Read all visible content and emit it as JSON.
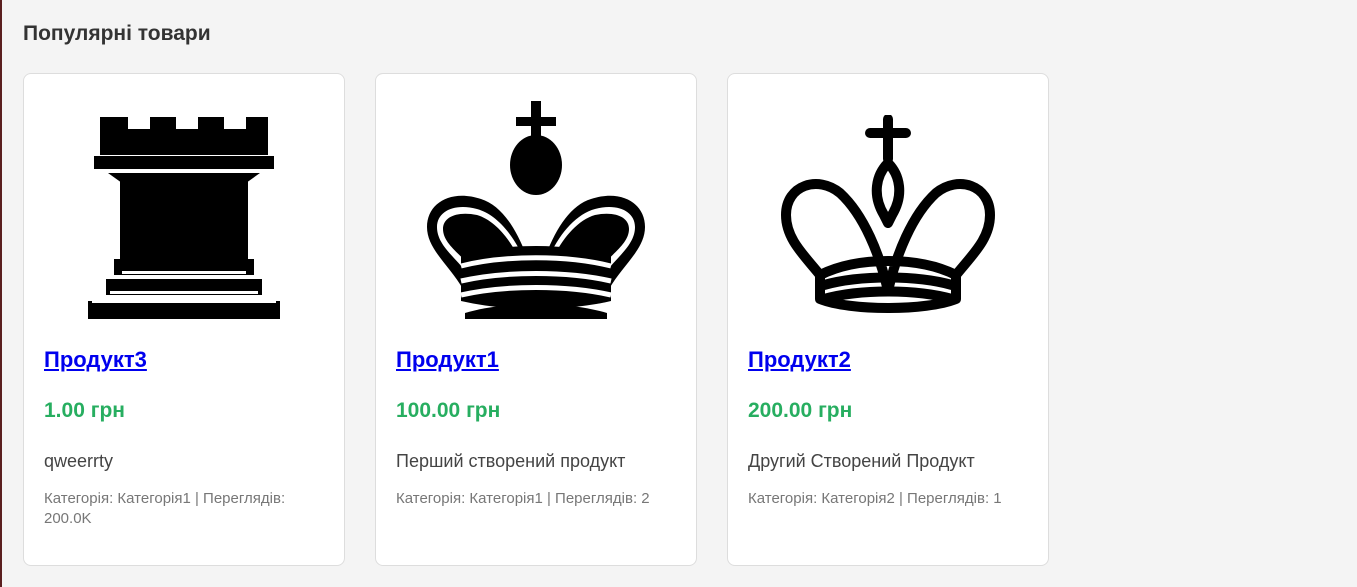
{
  "section": {
    "title": "Популярні товари"
  },
  "products": [
    {
      "icon": "chess-rook-black-icon",
      "name": "Продукт3",
      "price": "1.00 грн",
      "description": "qweerrty",
      "meta": "Категорія: Категорія1 | Переглядів: 200.0K"
    },
    {
      "icon": "chess-king-black-icon",
      "name": "Продукт1",
      "price": "100.00 грн",
      "description": "Перший створений продукт",
      "meta": "Категорія: Категорія1 | Переглядів: 2"
    },
    {
      "icon": "chess-king-white-icon",
      "name": "Продукт2",
      "price": "200.00 грн",
      "description": "Другий Створений Продукт",
      "meta": "Категорія: Категорія2 | Переглядів: 1"
    }
  ],
  "colors": {
    "link": "#0000ee",
    "price": "#27ae60",
    "background": "#f4f4f4"
  }
}
